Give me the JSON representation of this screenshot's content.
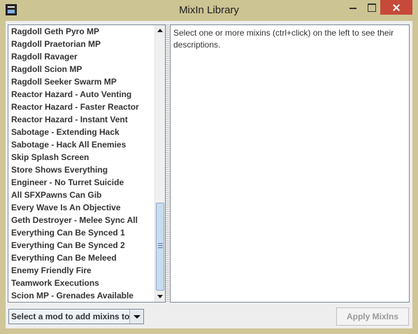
{
  "window": {
    "title": "MixIn Library",
    "app_icon": "java-app-icon",
    "controls": [
      "minimize-icon",
      "maximize-icon",
      "close-icon"
    ]
  },
  "mixin_list": {
    "items": [
      "Ragdoll Geth Pyro MP",
      "Ragdoll Praetorian MP",
      "Ragdoll Ravager",
      "Ragdoll Scion MP",
      "Ragdoll Seeker Swarm MP",
      "Reactor Hazard - Auto Venting",
      "Reactor Hazard - Faster Reactor",
      "Reactor Hazard - Instant Vent",
      "Sabotage - Extending Hack",
      "Sabotage - Hack All Enemies",
      "Skip Splash Screen",
      "Store Shows Everything",
      "Engineer - No Turret Suicide",
      "All SFXPawns Can Gib",
      "Every Wave Is An Objective",
      "Geth Destroyer - Melee Sync All",
      "Everything Can Be Synced 1",
      "Everything Can Be Synced 2",
      "Everything Can Be Meleed",
      "Enemy Friendly Fire",
      "Teamwork Executions",
      "Scion MP - Grenades Available"
    ]
  },
  "description": {
    "text": "Select one or more mixins (ctrl+click) on the left to see their descriptions."
  },
  "footer": {
    "mod_select_label": "Select a mod to add mixins to",
    "apply_label": "Apply MixIns"
  },
  "colors": {
    "title_bar": "#cdc493",
    "close_button": "#c7493a",
    "panel_border": "#7a8a99",
    "scroll_thumb": "#c8dcef"
  }
}
